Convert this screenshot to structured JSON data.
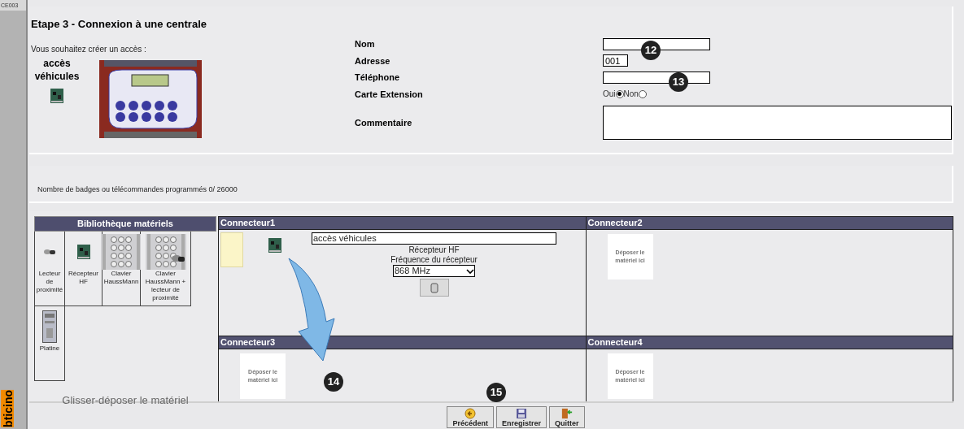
{
  "page_code": "CE003",
  "brand": "bticino",
  "title": "Etape 3 - Connexion à une centrale",
  "access": {
    "prompt": "Vous souhaitez créer un accès :",
    "type_label": "accès véhicules"
  },
  "form": [
    {
      "kind": "text",
      "label": "Nom"
    },
    {
      "kind": "short_text",
      "label": "Adresse",
      "value": "001"
    },
    {
      "kind": "text",
      "label": "Téléphone"
    },
    {
      "kind": "radio",
      "label": "Carte Extension",
      "options": [
        {
          "label": "Oui",
          "selected": true
        },
        {
          "label": "Non",
          "selected": false
        }
      ]
    },
    {
      "kind": "textarea",
      "label": "Commentaire"
    }
  ],
  "badge_count": "Nombre de badges ou télécommandes programmés 0/ 26000",
  "library": {
    "title": "Bibliothèque matériels",
    "items": [
      {
        "kind": "reader",
        "label": "Lecteur de proximité"
      },
      {
        "kind": "receiver",
        "label": "Récepteur HF"
      },
      {
        "kind": "keypad",
        "label": "Clavier HaussMann"
      },
      {
        "kind": "keypad_reader",
        "label": "Clavier HaussMann + lecteur de proximité"
      },
      {
        "kind": "panel",
        "label": "Platine"
      }
    ],
    "hint": "Glisser-déposer le matériel"
  },
  "connectors": [
    {
      "title": "Connecteur1",
      "device": {
        "name": "accès véhicules",
        "type": "Récepteur HF",
        "frequency_label": "Fréquence du récepteur",
        "frequency": "868 MHz"
      }
    },
    {
      "title": "Connecteur2",
      "drop_hint": "Déposer le matériel ici"
    },
    {
      "title": "Connecteur3",
      "drop_hint": "Déposer le matériel ici"
    },
    {
      "title": "Connecteur4",
      "drop_hint": "Déposer le matériel ici"
    }
  ],
  "callouts": [
    "12",
    "13",
    "14",
    "15"
  ],
  "buttons": [
    {
      "kind": "back",
      "label": "Précédent"
    },
    {
      "kind": "save",
      "label": "Enregistrer"
    },
    {
      "kind": "quit",
      "label": "Quitter"
    }
  ]
}
